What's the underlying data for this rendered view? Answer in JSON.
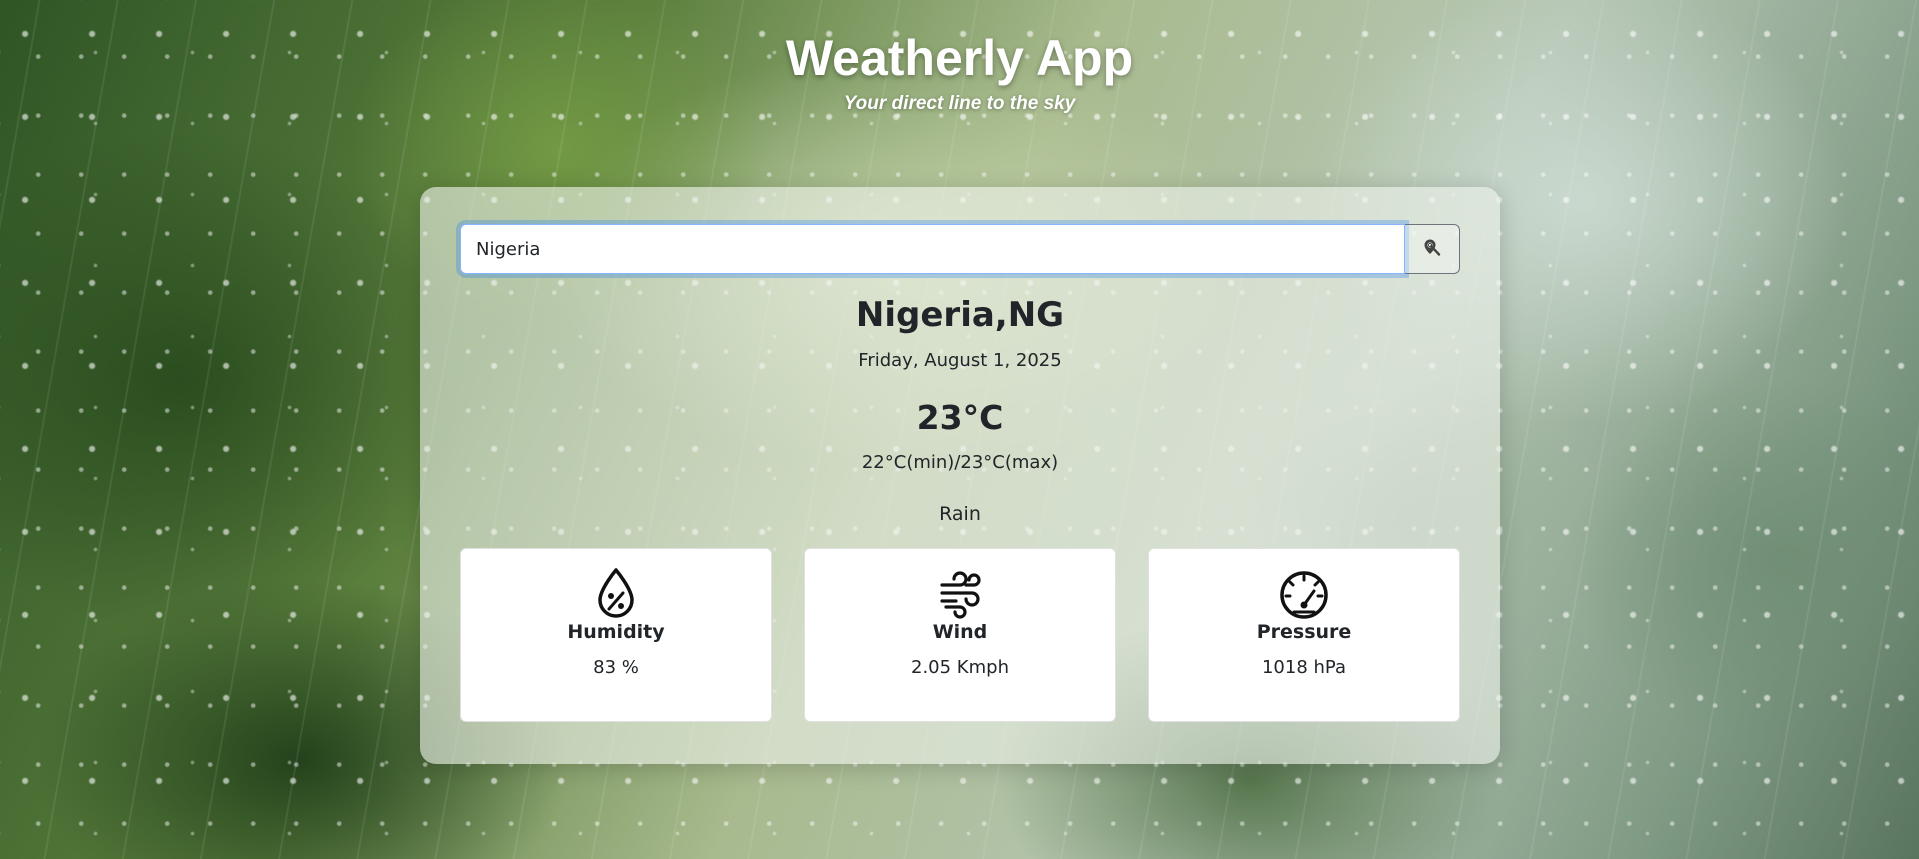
{
  "header": {
    "title": "Weatherly App",
    "subtitle": "Your direct line to the sky"
  },
  "search": {
    "value": "Nigeria",
    "button_icon": "search-location-icon"
  },
  "weather": {
    "location": "Nigeria,NG",
    "date": "Friday, August 1, 2025",
    "temperature": "23°C",
    "min_max": "22°C(min)/23°C(max)",
    "condition": "Rain"
  },
  "metrics": [
    {
      "icon": "humidity-drop-icon",
      "label": "Humidity",
      "value": "83 %"
    },
    {
      "icon": "wind-icon",
      "label": "Wind",
      "value": "2.05 Kmph"
    },
    {
      "icon": "pressure-gauge-icon",
      "label": "Pressure",
      "value": "1018 hPa"
    }
  ],
  "colors": {
    "accent_focus": "#86b7fe",
    "text": "#212529",
    "title_text": "#ffffff"
  }
}
